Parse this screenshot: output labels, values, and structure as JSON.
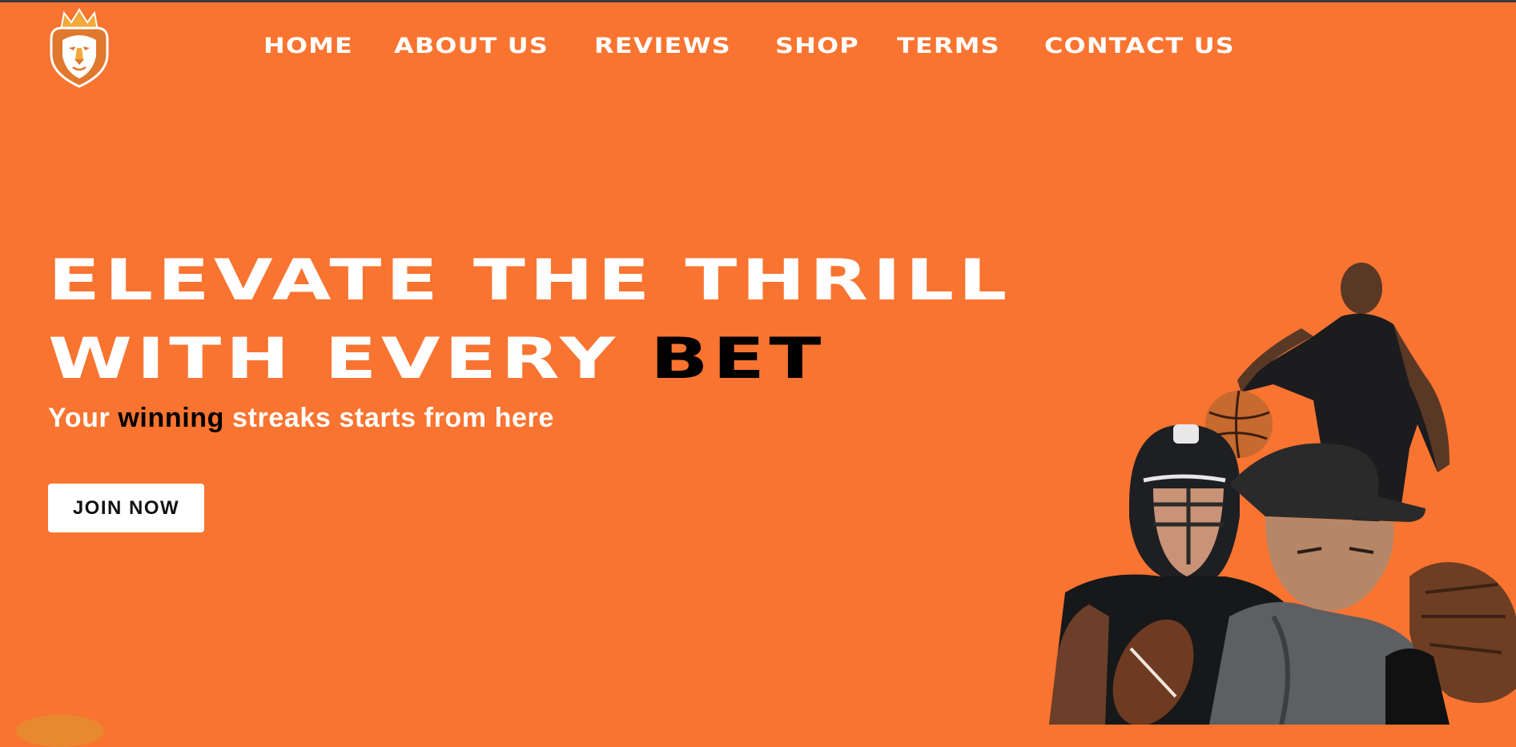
{
  "brand": {
    "logo_icon": "crowned-lion-icon",
    "colors": {
      "background": "#F97430",
      "accent": "#000000",
      "crown": "#F3A93C",
      "mane": "#E0782E"
    }
  },
  "nav": {
    "items": [
      {
        "label": "HOME"
      },
      {
        "label": "ABOUT US"
      },
      {
        "label": "REVIEWS"
      },
      {
        "label": "SHOP"
      },
      {
        "label": "TERMS"
      },
      {
        "label": "CONTACT US"
      }
    ]
  },
  "hero": {
    "line1": "ELEVATE THE THRILL",
    "line2_prefix": "WITH EVERY ",
    "line2_accent": "BET",
    "subtitle_before": "Your ",
    "subtitle_accent": "winning",
    "subtitle_after": " streaks starts from here",
    "cta_label": "JOIN NOW",
    "image_icon": "athletes-collage-image"
  }
}
